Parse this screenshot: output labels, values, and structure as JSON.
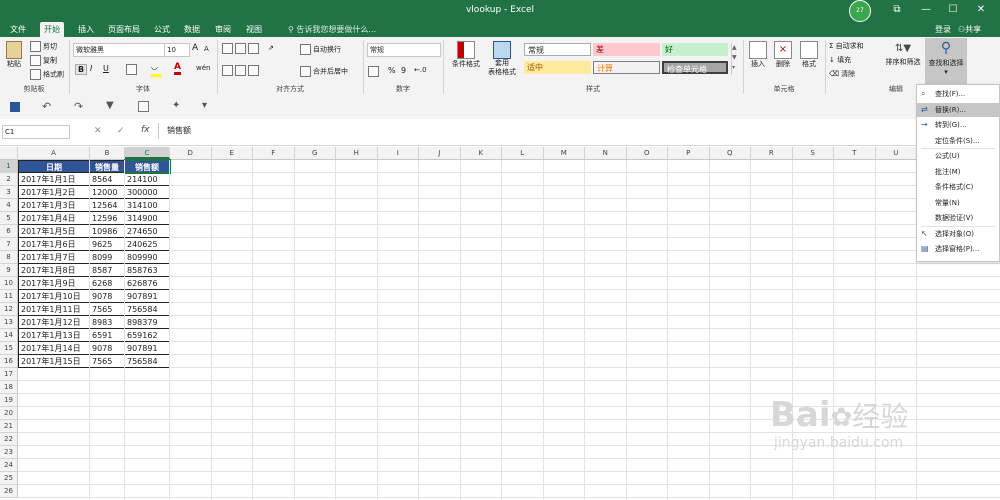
{
  "window": {
    "title": "vlookup - Excel",
    "avatar_label": "27",
    "controls": {
      "restore": "⧉",
      "minimize": "—",
      "maximize": "☐",
      "close": "✕"
    }
  },
  "tabs": [
    "文件",
    "开始",
    "插入",
    "页面布局",
    "公式",
    "数据",
    "审阅",
    "视图"
  ],
  "active_tab": "开始",
  "tell_me": "告诉我您想要做什么...",
  "account": {
    "login": "登录",
    "share": "共享"
  },
  "ribbon": {
    "clipboard": {
      "paste": "粘贴",
      "cut": "剪切",
      "copy": "复制",
      "format_painter": "格式刷",
      "label": "剪贴板"
    },
    "font": {
      "name": "微软雅黑",
      "size": "10",
      "grow": "A",
      "shrink": "A",
      "bold": "B",
      "italic": "I",
      "underline": "U",
      "wen": "wén",
      "label": "字体"
    },
    "alignment": {
      "wrap": "自动换行",
      "merge": "合并后居中",
      "label": "对齐方式"
    },
    "number": {
      "format": "常规",
      "percent": "%",
      "comma": "9",
      "label": "数字"
    },
    "styles": {
      "conditional": "条件格式",
      "table": "套用\n表格格式",
      "normal": "常规",
      "bad": "差",
      "good": "好",
      "neutral": "适中",
      "calc": "计算",
      "check": "检查单元格",
      "label": "样式"
    },
    "cells": {
      "insert": "插入",
      "delete": "删除",
      "format": "格式",
      "label": "单元格"
    },
    "editing": {
      "autosum": "自动求和",
      "fill": "填充",
      "clear": "清除",
      "sort": "排序和筛选",
      "find": "查找和选择",
      "label": "编辑"
    }
  },
  "colors": {
    "excel_green": "#217346",
    "header_blue": "#2f5597",
    "bad_bg": "#ffc7ce",
    "good_bg": "#c6efce",
    "neutral_bg": "#ffeb9c",
    "calc_bg": "#f2f2f2",
    "check_bg": "#a5a5a5"
  },
  "formula_bar": {
    "name_box": "C1",
    "fx": "fx",
    "content": "销售额"
  },
  "columns": [
    "A",
    "B",
    "C",
    "D",
    "E",
    "F",
    "G",
    "H",
    "I",
    "J",
    "K",
    "L",
    "M",
    "N",
    "O",
    "P",
    "Q",
    "R",
    "S",
    "T",
    "U"
  ],
  "table": {
    "headers": [
      "日期",
      "销售量",
      "销售额"
    ],
    "rows": [
      [
        "2017年1月1日",
        "8564",
        "214100"
      ],
      [
        "2017年1月2日",
        "12000",
        "300000"
      ],
      [
        "2017年1月3日",
        "12564",
        "314100"
      ],
      [
        "2017年1月4日",
        "12596",
        "314900"
      ],
      [
        "2017年1月5日",
        "10986",
        "274650"
      ],
      [
        "2017年1月6日",
        "9625",
        "240625"
      ],
      [
        "2017年1月7日",
        "8099",
        "809990"
      ],
      [
        "2017年1月8日",
        "8587",
        "858763"
      ],
      [
        "2017年1月9日",
        "6268",
        "626876"
      ],
      [
        "2017年1月10日",
        "9078",
        "907891"
      ],
      [
        "2017年1月11日",
        "7565",
        "756584"
      ],
      [
        "2017年1月12日",
        "8983",
        "898379"
      ],
      [
        "2017年1月13日",
        "6591",
        "659162"
      ],
      [
        "2017年1月14日",
        "9078",
        "907891"
      ],
      [
        "2017年1月15日",
        "7565",
        "756584"
      ]
    ]
  },
  "find_menu": [
    {
      "label": "查找(F)...",
      "icon": "⌕",
      "sep_after": false,
      "hl": false
    },
    {
      "label": "替换(R)...",
      "icon": "⇄",
      "sep_after": false,
      "hl": true
    },
    {
      "label": "转到(G)...",
      "icon": "→",
      "sep_after": false,
      "hl": false
    },
    {
      "label": "定位条件(S)...",
      "icon": "",
      "sep_after": true,
      "hl": false
    },
    {
      "label": "公式(U)",
      "icon": "",
      "sep_after": false,
      "hl": false
    },
    {
      "label": "批注(M)",
      "icon": "",
      "sep_after": false,
      "hl": false
    },
    {
      "label": "条件格式(C)",
      "icon": "",
      "sep_after": false,
      "hl": false
    },
    {
      "label": "常量(N)",
      "icon": "",
      "sep_after": false,
      "hl": false
    },
    {
      "label": "数据验证(V)",
      "icon": "",
      "sep_after": true,
      "hl": false
    },
    {
      "label": "选择对象(O)",
      "icon": "↖",
      "sep_after": false,
      "hl": false
    },
    {
      "label": "选择窗格(P)...",
      "icon": "▤",
      "sep_after": false,
      "hl": false
    }
  ],
  "watermark": {
    "logo": "Bai",
    "logo_cn": "经验",
    "url": "jingyan.baidu.com"
  }
}
